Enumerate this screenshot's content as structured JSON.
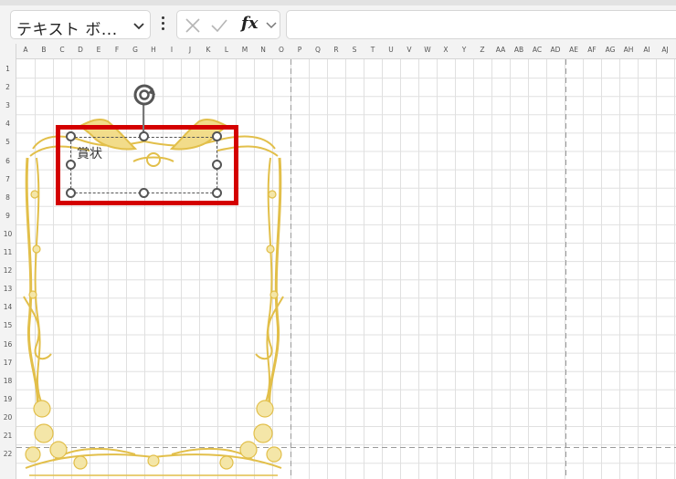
{
  "toolbar": {
    "name_box": {
      "value": "テキスト ボ...",
      "dropdown_icon": "chevron-down-icon"
    },
    "more_icon": "more-vertical-icon",
    "cancel_icon": "close-icon",
    "enter_icon": "check-icon",
    "function_label": "fx",
    "function_dropdown_icon": "chevron-down-icon",
    "formula_value": ""
  },
  "sheet": {
    "columns": [
      "A",
      "B",
      "C",
      "D",
      "E",
      "F",
      "G",
      "H",
      "I",
      "J",
      "K",
      "L",
      "M",
      "N",
      "O",
      "P",
      "Q",
      "R",
      "S",
      "T",
      "U",
      "V",
      "W",
      "X",
      "Y",
      "Z",
      "AA",
      "AB",
      "AC",
      "AD",
      "AE",
      "AF",
      "AG",
      "AH",
      "AI",
      "AJ"
    ],
    "rows": [
      "1",
      "2",
      "3",
      "4",
      "5",
      "6",
      "7",
      "8",
      "9",
      "10",
      "11",
      "12",
      "13",
      "14",
      "15",
      "16",
      "17",
      "18",
      "19",
      "20",
      "21",
      "22"
    ],
    "grid_color": "#e0e0e0",
    "page_break_color": "#9a9a9a"
  },
  "shape": {
    "text": "賞状",
    "highlight_color": "#d40000",
    "frame_color": "#e2bf4a",
    "rotate_icon": "rotate-icon"
  }
}
